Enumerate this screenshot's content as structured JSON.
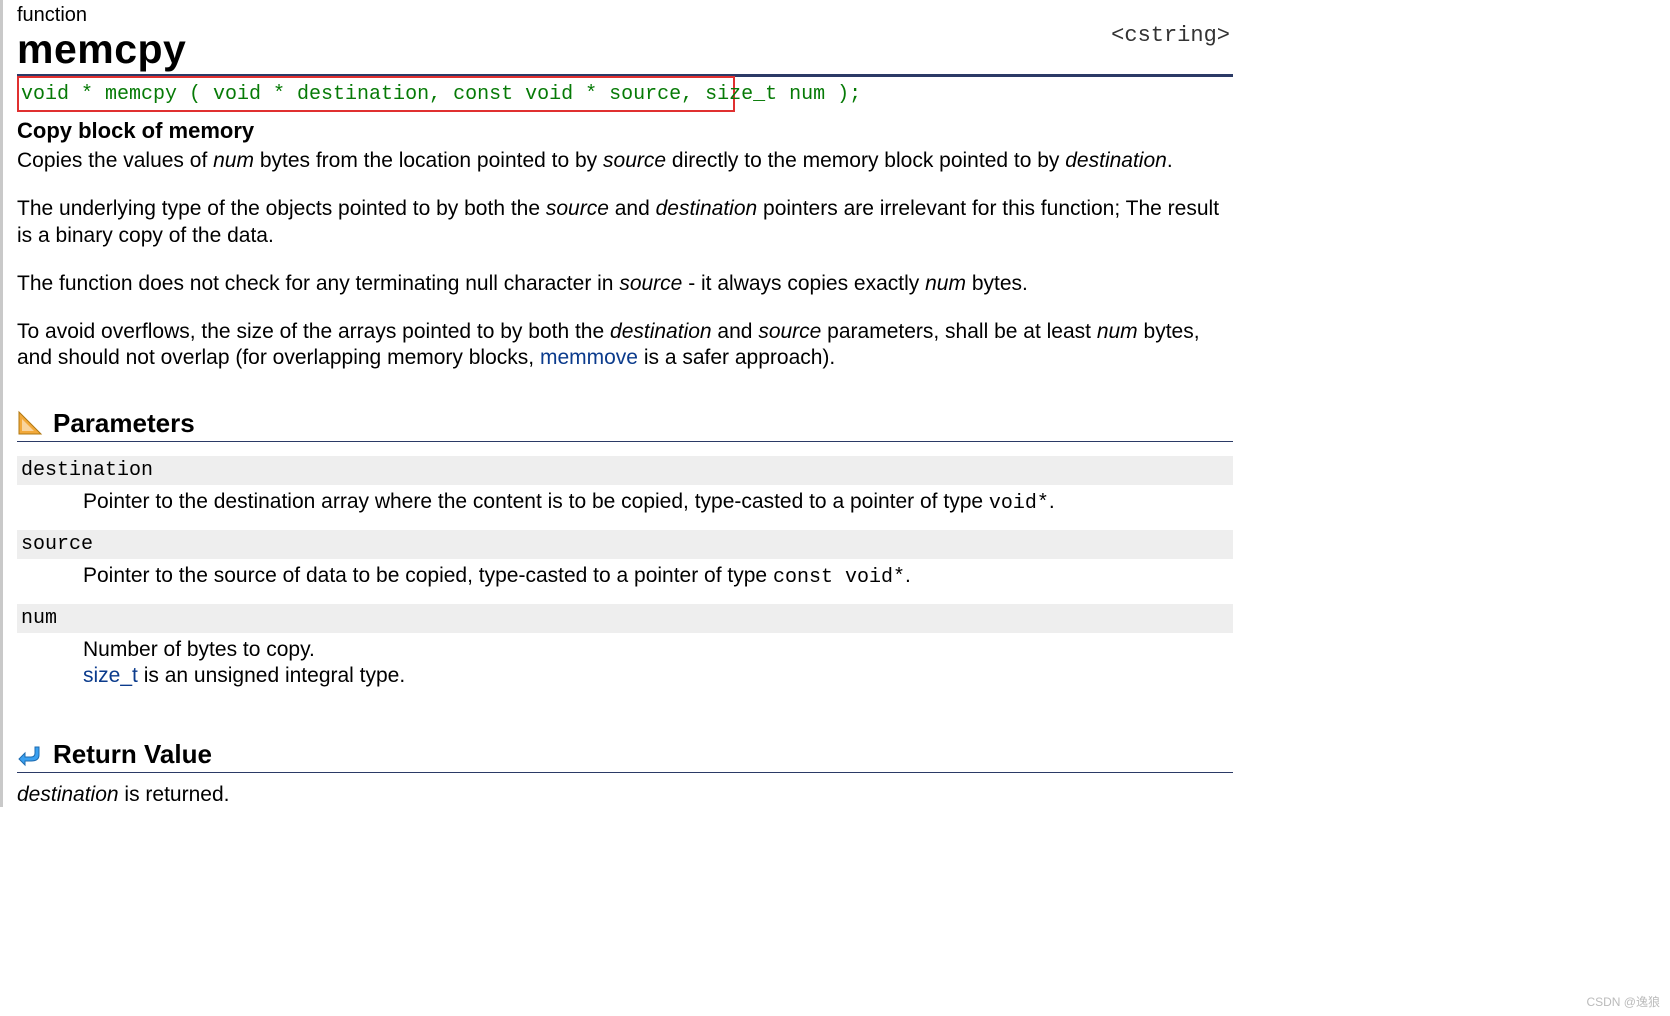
{
  "kind": "function",
  "title": "memcpy",
  "header_include": "<cstring>",
  "signature": "void * memcpy ( void * destination, const void * source, size_t num );",
  "subtitle": "Copy block of memory",
  "desc": {
    "p1_a": "Copies the values of ",
    "p1_num": "num",
    "p1_b": " bytes from the location pointed to by ",
    "p1_src": "source",
    "p1_c": " directly to the memory block pointed to by ",
    "p1_dst": "destination",
    "p1_d": ".",
    "p2_a": "The underlying type of the objects pointed to by both the ",
    "p2_src": "source",
    "p2_b": " and ",
    "p2_dst": "destination",
    "p2_c": " pointers are irrelevant for this function; The result is a binary copy of the data.",
    "p3_a": "The function does not check for any terminating null character in ",
    "p3_src": "source",
    "p3_b": " - it always copies exactly ",
    "p3_num": "num",
    "p3_c": " bytes.",
    "p4_a": "To avoid overflows, the size of the arrays pointed to by both the ",
    "p4_dst": "destination",
    "p4_b": " and ",
    "p4_src": "source",
    "p4_c": " parameters, shall be at least ",
    "p4_num": "num",
    "p4_d": " bytes, and should not overlap (for overlapping memory blocks, ",
    "p4_link": "memmove",
    "p4_e": " is a safer approach)."
  },
  "sections": {
    "parameters": "Parameters",
    "return_value": "Return Value"
  },
  "params": [
    {
      "name": "destination",
      "desc_a": "Pointer to the destination array where the content is to be copied, type-casted to a pointer of type ",
      "code": "void*",
      "desc_b": "."
    },
    {
      "name": "source",
      "desc_a": "Pointer to the source of data to be copied, type-casted to a pointer of type ",
      "code": "const void*",
      "desc_b": "."
    },
    {
      "name": "num",
      "desc_a": "Number of bytes to copy.",
      "line2_link": "size_t",
      "line2_rest": " is an unsigned integral type."
    }
  ],
  "return": {
    "dst": "destination",
    "rest": " is returned."
  },
  "watermark": "CSDN @逸狼"
}
